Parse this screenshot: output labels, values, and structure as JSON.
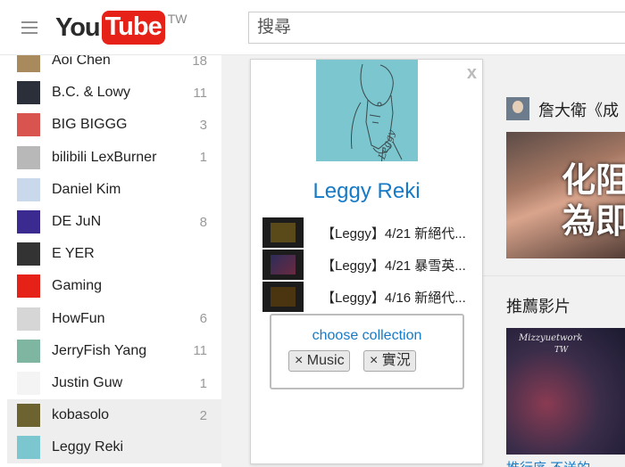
{
  "header": {
    "logo_you": "You",
    "logo_tube": "Tube",
    "logo_region": "TW",
    "search_placeholder": "搜尋"
  },
  "sidebar": {
    "items": [
      {
        "label": "Aoi Chen",
        "count": "18",
        "avatar_color": "#a88a5c"
      },
      {
        "label": "B.C. & Lowy",
        "count": "11",
        "avatar_color": "#2b2f3a"
      },
      {
        "label": "BIG BIGGG",
        "count": "3",
        "avatar_color": "#d9534f"
      },
      {
        "label": "bilibili LexBurner",
        "count": "1",
        "avatar_color": "#b8b8b8"
      },
      {
        "label": "Daniel Kim",
        "count": "",
        "avatar_color": "#c9d8ea"
      },
      {
        "label": "DE JuN",
        "count": "8",
        "avatar_color": "#3b2a8f"
      },
      {
        "label": "E YER",
        "count": "",
        "avatar_color": "#333333"
      },
      {
        "label": "Gaming",
        "count": "",
        "avatar_color": "#e62117"
      },
      {
        "label": "HowFun",
        "count": "6",
        "avatar_color": "#d6d6d6"
      },
      {
        "label": "JerryFish Yang",
        "count": "11",
        "avatar_color": "#7fb6a1"
      },
      {
        "label": "Justin Guw",
        "count": "1",
        "avatar_color": "#f4f4f4"
      },
      {
        "label": "kobasolo",
        "count": "2",
        "avatar_color": "#6d6330"
      },
      {
        "label": "Leggy Reki",
        "count": "",
        "avatar_color": "#7bc6cf"
      }
    ],
    "active_index": 12,
    "hover_index": 11
  },
  "popup": {
    "channel_name": "Leggy Reki",
    "close_label": "x",
    "videos": [
      {
        "title": "【Leggy】4/21 新絕代..."
      },
      {
        "title": "【Leggy】4/21 暴雪英..."
      },
      {
        "title": "【Leggy】4/16 新絕代..."
      }
    ],
    "collection": {
      "link": "choose collection",
      "tags": [
        "× Music",
        "× 實況"
      ]
    }
  },
  "main": {
    "channel_title": "詹大衛《成",
    "thumb_text": "化阻\n為即",
    "recommended_title": "推薦影片",
    "rec_thumb_text1": "Mizzyuetwork",
    "rec_thumb_text2": "TW",
    "rec_link_text": "推行序 不送的"
  },
  "colors": {
    "link_blue": "#167ac6",
    "youtube_red": "#e62117"
  }
}
